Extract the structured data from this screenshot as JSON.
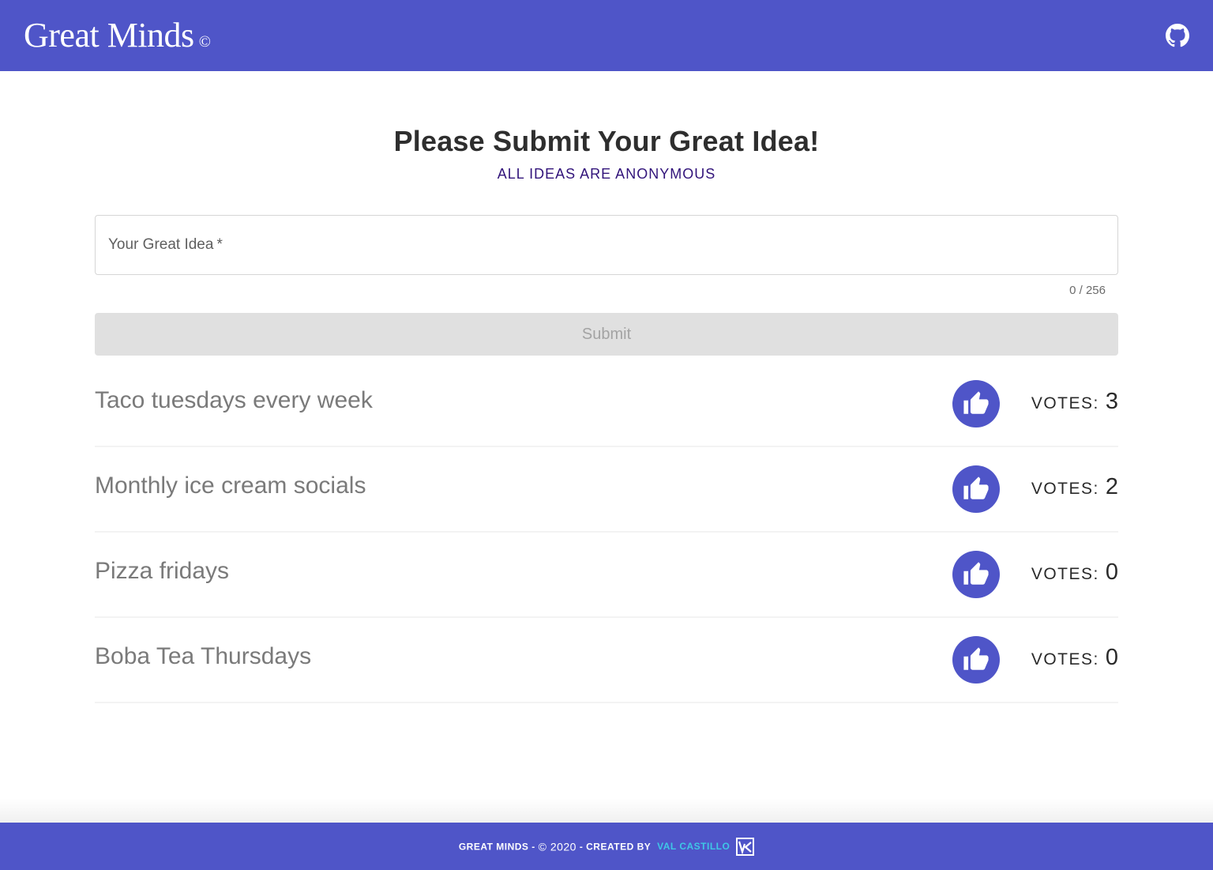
{
  "header": {
    "title": "Great Minds",
    "mark": "©",
    "github_icon": "github-icon"
  },
  "main": {
    "title": "Please Submit Your Great Idea!",
    "subtitle": "ALL IDEAS ARE ANONYMOUS",
    "field": {
      "label": "Your Great Idea",
      "required_mark": "*",
      "value": "",
      "counter": "0 / 256"
    },
    "submit_label": "Submit",
    "ideas": [
      {
        "text": "Taco tuesdays every week",
        "votes_label": "VOTES:",
        "votes": "3"
      },
      {
        "text": "Monthly ice cream socials",
        "votes_label": "VOTES:",
        "votes": "2"
      },
      {
        "text": "Pizza fridays",
        "votes_label": "VOTES:",
        "votes": "0"
      },
      {
        "text": "Boba Tea Thursdays",
        "votes_label": "VOTES:",
        "votes": "0"
      }
    ],
    "vote_icon": "thumbs-up-icon"
  },
  "footer": {
    "prefix": "GREAT MINDS -",
    "year": "© 2020",
    "created_by": "- CREATED BY",
    "author": "VAL CASTILLO",
    "logo_icon": "vc-logo-icon"
  },
  "colors": {
    "brand": "#4f55c8",
    "subtitle": "#31137a",
    "author_link": "#3fc7e6"
  }
}
